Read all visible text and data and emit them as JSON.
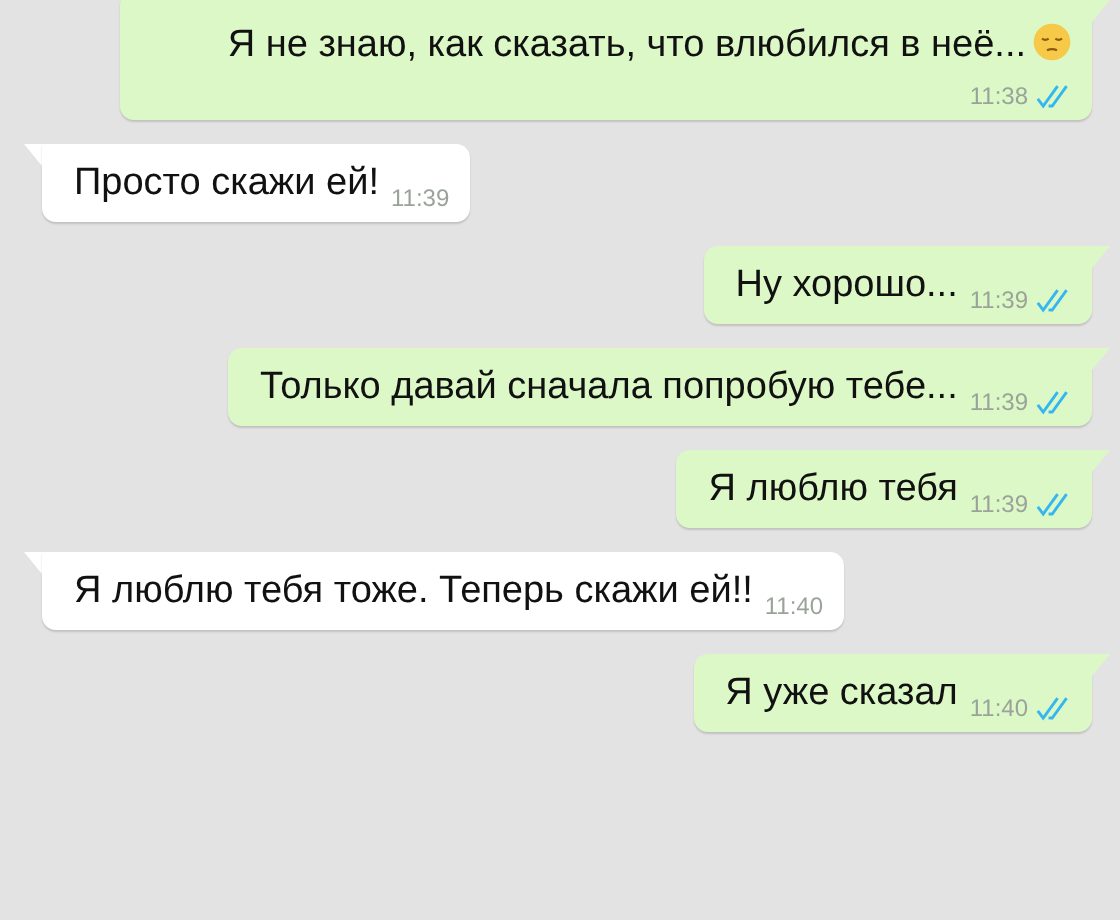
{
  "messages": [
    {
      "kind": "outgoing",
      "text": "Я не знаю, как сказать, что влюбился в неё...",
      "emoji": true,
      "time": "11:38",
      "read": true
    },
    {
      "kind": "incoming",
      "text": "Просто скажи ей!",
      "time": "11:39"
    },
    {
      "kind": "outgoing",
      "text": "Ну хорошо...",
      "time": "11:39",
      "read": true
    },
    {
      "kind": "outgoing",
      "text": "Только давай сначала попробую тебе...",
      "time": "11:39",
      "read": true
    },
    {
      "kind": "outgoing",
      "text": "Я люблю тебя",
      "time": "11:39",
      "read": true
    },
    {
      "kind": "incoming",
      "text": "Я люблю тебя тоже. Теперь скажи ей!!",
      "time": "11:40"
    },
    {
      "kind": "outgoing",
      "text": "Я уже сказал",
      "time": "11:40",
      "read": true
    }
  ]
}
